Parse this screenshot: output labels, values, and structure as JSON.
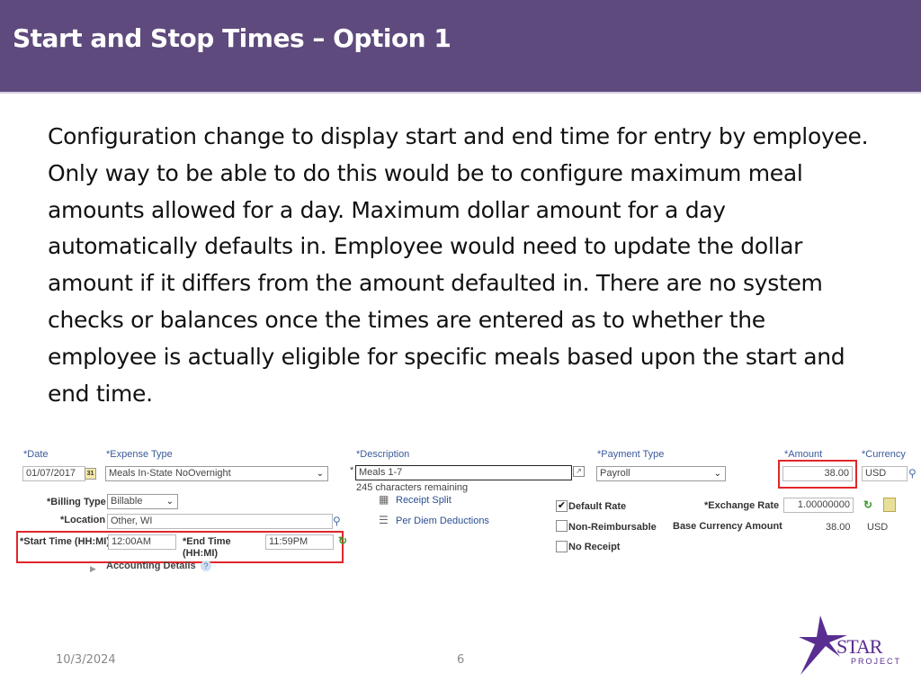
{
  "slide": {
    "title": "Start and Stop Times – Option 1",
    "body": "Configuration change to display start and end time for entry by employee.  Only way to be able to do this would be to configure maximum meal amounts allowed for a day. Maximum dollar amount for a day automatically defaults in.  Employee would need to update the dollar amount if it differs from the amount defaulted in. There are no system checks or balances once the times are entered as to whether the employee is actually eligible for specific meals based upon the start and end time.",
    "footer_date": "10/3/2024",
    "page_number": "6",
    "logo_text": "STAR",
    "logo_subtext": "PROJECT"
  },
  "form": {
    "date_label": "*Date",
    "date_value": "01/07/2017",
    "calendar_icon_text": "31",
    "expense_type_label": "*Expense Type",
    "expense_type_value": "Meals In-State NoOvernight",
    "billing_type_label": "*Billing Type",
    "billing_type_value": "Billable",
    "location_label": "*Location",
    "location_value": "Other, WI",
    "start_time_label": "*Start Time (HH:MI)",
    "start_time_value": "12:00AM",
    "end_time_label_1": "*End Time",
    "end_time_label_2": "(HH:MI)",
    "end_time_value": "11:59PM",
    "accounting_details_label": "Accounting Details",
    "help_icon_text": "?",
    "description_label": "*Description",
    "description_required_mark": "*",
    "description_value": "Meals 1-7",
    "characters_remaining": "245 characters remaining",
    "receipt_split_label": "Receipt Split",
    "per_diem_label": "Per Diem Deductions",
    "payment_type_label": "*Payment Type",
    "payment_type_value": "Payroll",
    "default_rate_label": "Default Rate",
    "default_rate_checked": true,
    "non_reimbursable_label": "Non-Reimbursable",
    "non_reimbursable_checked": false,
    "no_receipt_label": "No Receipt",
    "no_receipt_checked": false,
    "amount_label": "*Amount",
    "amount_value": "38.00",
    "currency_label": "*Currency",
    "currency_value": "USD",
    "exchange_rate_label": "*Exchange Rate",
    "exchange_rate_value": "1.00000000",
    "base_currency_label": "Base Currency Amount",
    "base_currency_amount": "38.00",
    "base_currency_code": "USD"
  },
  "colors": {
    "title_bar": "#5e4a7c",
    "highlight_box": "#e0262b",
    "link": "#2b4f91",
    "logo": "#5a2d91"
  }
}
